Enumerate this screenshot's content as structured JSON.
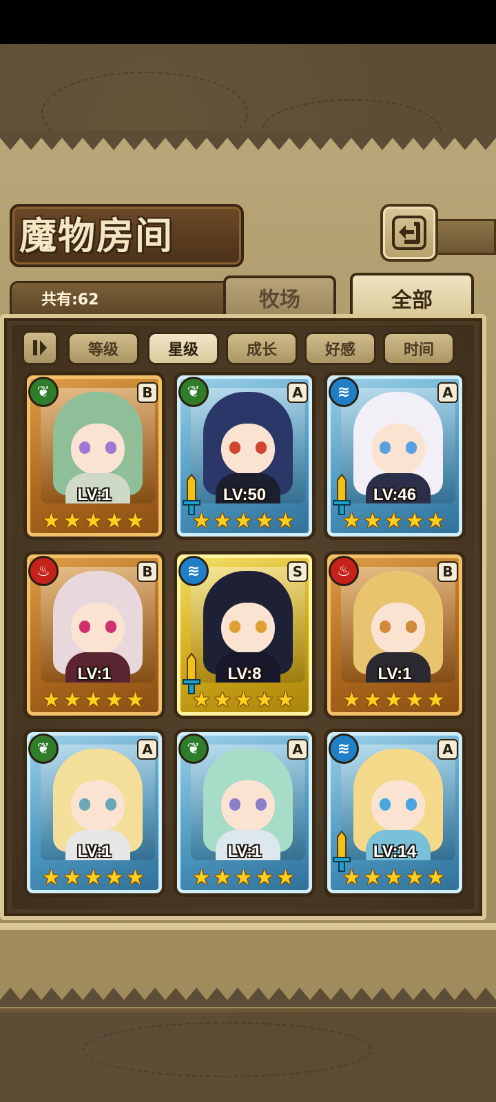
{
  "title": "魔物房间",
  "count_label": "共有:62",
  "tabs": {
    "farm": "牧场",
    "all": "全部"
  },
  "sort": {
    "toggle_icon": "sort-toggle-icon",
    "buttons": [
      "等级",
      "星级",
      "成长",
      "好感",
      "时间"
    ],
    "active": "星级"
  },
  "cards": [
    {
      "element": "leaf",
      "rank": "B",
      "lv": "LV:1",
      "stars": 5,
      "sword": false,
      "hair": "#8fbf98",
      "eye": "#9d7ad1",
      "body": "#cfd9c7"
    },
    {
      "element": "leaf",
      "rank": "A",
      "lv": "LV:50",
      "stars": 5,
      "sword": true,
      "hair": "#2b3768",
      "eye": "#d2452e",
      "body": "#1c1f2e"
    },
    {
      "element": "water",
      "rank": "A",
      "lv": "LV:46",
      "stars": 5,
      "sword": true,
      "hair": "#f2f0f6",
      "eye": "#5aa0e0",
      "body": "#2c2f4a"
    },
    {
      "element": "fire",
      "rank": "B",
      "lv": "LV:1",
      "stars": 5,
      "sword": false,
      "hair": "#e8d8dc",
      "eye": "#d0306e",
      "body": "#5a2430"
    },
    {
      "element": "water",
      "rank": "S",
      "lv": "LV:8",
      "stars": 5,
      "sword": true,
      "hair": "#1e2036",
      "eye": "#e0a032",
      "body": "#18182a"
    },
    {
      "element": "fire",
      "rank": "B",
      "lv": "LV:1",
      "stars": 5,
      "sword": false,
      "hair": "#e9c46e",
      "eye": "#d08a3a",
      "body": "#2a2a30"
    },
    {
      "element": "leaf",
      "rank": "A",
      "lv": "LV:1",
      "stars": 5,
      "sword": false,
      "hair": "#f3de9a",
      "eye": "#6aa8b8",
      "body": "#e6e6e6"
    },
    {
      "element": "leaf",
      "rank": "A",
      "lv": "LV:1",
      "stars": 5,
      "sword": false,
      "hair": "#a7dcc6",
      "eye": "#8a7fc8",
      "body": "#dde8ee"
    },
    {
      "element": "water",
      "rank": "A",
      "lv": "LV:14",
      "stars": 5,
      "sword": true,
      "hair": "#f4d98a",
      "eye": "#4aa6e0",
      "body": "#7ac0d8"
    }
  ],
  "colors": {
    "leaf": "#2f7d2a",
    "fire": "#c5221c",
    "water": "#1f7fc7",
    "star": "#ffcf1f",
    "panel": "#a89565"
  },
  "icons": {
    "back": "back-arrow-icon",
    "leaf": "leaf-icon",
    "fire": "flame-icon",
    "water": "water-wave-icon",
    "star": "star-icon",
    "sword": "sword-icon"
  }
}
